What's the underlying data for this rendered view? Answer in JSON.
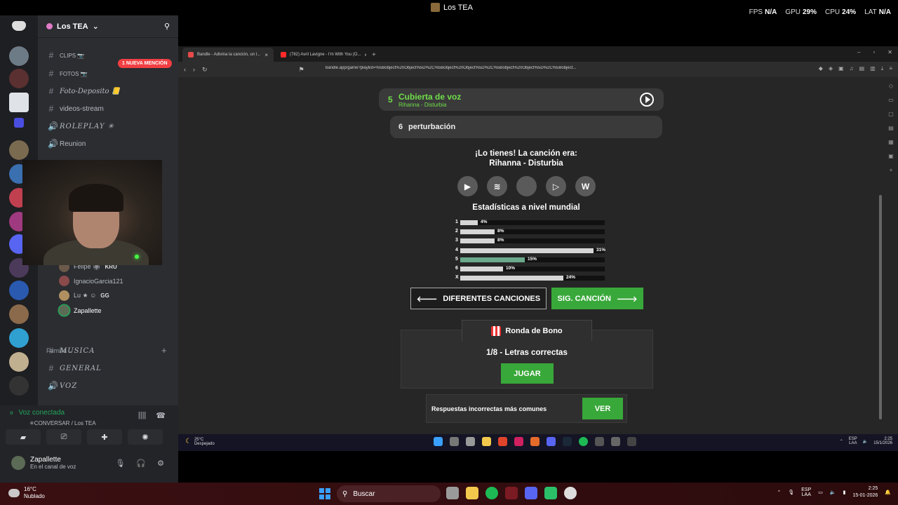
{
  "overlay": {
    "window_title": "Los TEA",
    "stats": [
      {
        "key": "FPS",
        "value": "N/A"
      },
      {
        "key": "GPU",
        "value": "29%"
      },
      {
        "key": "CPU",
        "value": "24%"
      },
      {
        "key": "LAT",
        "value": "N/A"
      }
    ]
  },
  "discord": {
    "server_name": "Los TEA",
    "mention_badge": "1 NUEVA MENCIÓN",
    "channels": [
      {
        "label": "CLIPS 📷",
        "type": "text"
      },
      {
        "label": "FOTOS 📷",
        "type": "text"
      },
      {
        "label": "Foto-Deposito 📒",
        "type": "text"
      },
      {
        "label": "videos-stream",
        "type": "text"
      },
      {
        "label": "ROLEPLAY ✳",
        "type": "voice"
      },
      {
        "label": "Reunion",
        "type": "voice"
      }
    ],
    "voice_users": [
      {
        "name": "Felipe 🏵",
        "tag": "KRU"
      },
      {
        "name": "IgnacioGarcia121",
        "tag": ""
      },
      {
        "name": "Lu ★ ☺",
        "tag": "GG"
      },
      {
        "name": "Zapallette",
        "tag": ""
      }
    ],
    "category": "Familia ⌄",
    "category_channels": [
      {
        "label": "MUSICA",
        "type": "text"
      },
      {
        "label": "GENERAL",
        "type": "text"
      },
      {
        "label": "VOZ",
        "type": "voice"
      }
    ],
    "voice_panel": {
      "status": "Voz conectada",
      "location": "✳CONVERSAR / Los TEA"
    },
    "user": {
      "name": "Zapallette",
      "status": "En el canal de voz"
    }
  },
  "browser": {
    "tabs": [
      {
        "label": "Bandle - Adivina la canción, un l...",
        "active": true
      },
      {
        "label": "(782) Avril Lavigne - I'm With You (O...",
        "active": false
      }
    ],
    "url": "bandle.app/game?playlist=%5Bobject%20Object%5D%2C%5Bobject%20Object%5D%2C%5Bobject%20Object%5D%2C%5Bobject..."
  },
  "game": {
    "guess5": {
      "num": "5",
      "title": "Cubierta de voz",
      "subtitle": "Rihanna - Disturbia"
    },
    "guess6": {
      "num": "6",
      "text": "perturbación"
    },
    "result_line1": "¡Lo tienes! La canción era:",
    "result_line2": "Rihanna - Disturbia",
    "links": [
      {
        "icon": "youtube-icon",
        "glyph": "▶"
      },
      {
        "icon": "spotify-icon",
        "glyph": "≋"
      },
      {
        "icon": "apple-icon",
        "glyph": ""
      },
      {
        "icon": "play-icon",
        "glyph": "▷"
      },
      {
        "icon": "wikipedia-icon",
        "glyph": "W"
      }
    ],
    "stats_title": "Estadísticas a nivel mundial",
    "distribution": [
      {
        "label": "1",
        "percent": 4,
        "text": "4%"
      },
      {
        "label": "2",
        "percent": 8,
        "text": "8%"
      },
      {
        "label": "3",
        "percent": 8,
        "text": "8%"
      },
      {
        "label": "4",
        "percent": 31,
        "text": "31%"
      },
      {
        "label": "5",
        "percent": 15,
        "text": "15%",
        "highlight": true
      },
      {
        "label": "6",
        "percent": 10,
        "text": "10%"
      },
      {
        "label": "X",
        "percent": 24,
        "text": "24%"
      }
    ],
    "btn_different": "DIFERENTES CANCIONES",
    "btn_next": "SIG. CANCIÓN",
    "bonus_title": "Ronda de Bono",
    "bonus_text": "1/8 - Letras correctas",
    "btn_play": "JUGAR",
    "wrong_text": "Respuestas incorrectas más comunes",
    "btn_see": "VER"
  },
  "inner_taskbar": {
    "temp": "25°C",
    "weather": "Despejado",
    "lang1": "ESP",
    "lang2": "LAA",
    "time": "2:25",
    "date": "15/1/2026"
  },
  "taskbar": {
    "temp": "16°C",
    "weather": "Nublado",
    "search": "Buscar",
    "lang1": "ESP",
    "lang2": "LAA",
    "time": "2:25",
    "date": "15-01-2026"
  },
  "colors": {
    "accent_green": "#39a83a",
    "guess_green": "#6fde4a",
    "winning_bar": "#6aa98b"
  }
}
